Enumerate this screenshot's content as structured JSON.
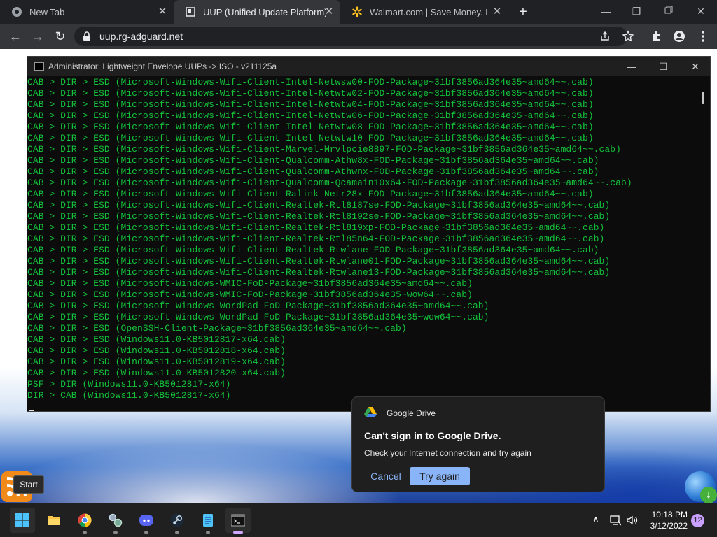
{
  "browser": {
    "tabs": [
      {
        "title": "New Tab",
        "close": "✕",
        "active": false
      },
      {
        "title": "UUP (Unified Update Platform) G",
        "close": "✕",
        "active": true
      },
      {
        "title": "Walmart.com | Save Money. Live",
        "close": "✕",
        "active": false
      }
    ],
    "new_tab": "+",
    "window_controls": {
      "minimize": "—",
      "maximize": "❐",
      "close": "✕"
    },
    "nav": {
      "back": "←",
      "forward": "→",
      "reload": "↻"
    },
    "url": "uup.rg-adguard.net",
    "icons": [
      "share-icon",
      "bookmark-star-icon",
      "extensions-icon",
      "profile-icon",
      "menu-icon"
    ]
  },
  "console": {
    "title": "Administrator:  Lightweight Envelope UUPs -> ISO - v211125a",
    "controls": {
      "minimize": "—",
      "maximize": "☐",
      "close": "✕"
    },
    "lines": [
      "CAB > DIR > ESD (Microsoft-Windows-Wifi-Client-Intel-Netwsw00-FOD-Package~31bf3856ad364e35~amd64~~.cab)",
      "CAB > DIR > ESD (Microsoft-Windows-Wifi-Client-Intel-Netwtw02-FOD-Package~31bf3856ad364e35~amd64~~.cab)",
      "CAB > DIR > ESD (Microsoft-Windows-Wifi-Client-Intel-Netwtw04-FOD-Package~31bf3856ad364e35~amd64~~.cab)",
      "CAB > DIR > ESD (Microsoft-Windows-Wifi-Client-Intel-Netwtw06-FOD-Package~31bf3856ad364e35~amd64~~.cab)",
      "CAB > DIR > ESD (Microsoft-Windows-Wifi-Client-Intel-Netwtw08-FOD-Package~31bf3856ad364e35~amd64~~.cab)",
      "CAB > DIR > ESD (Microsoft-Windows-Wifi-Client-Intel-Netwtw10-FOD-Package~31bf3856ad364e35~amd64~~.cab)",
      "CAB > DIR > ESD (Microsoft-Windows-Wifi-Client-Marvel-Mrvlpcie8897-FOD-Package~31bf3856ad364e35~amd64~~.cab)",
      "CAB > DIR > ESD (Microsoft-Windows-Wifi-Client-Qualcomm-Athw8x-FOD-Package~31bf3856ad364e35~amd64~~.cab)",
      "CAB > DIR > ESD (Microsoft-Windows-Wifi-Client-Qualcomm-Athwnx-FOD-Package~31bf3856ad364e35~amd64~~.cab)",
      "CAB > DIR > ESD (Microsoft-Windows-Wifi-Client-Qualcomm-Qcamain10x64-FOD-Package~31bf3856ad364e35~amd64~~.cab)",
      "CAB > DIR > ESD (Microsoft-Windows-Wifi-Client-Ralink-Netr28x-FOD-Package~31bf3856ad364e35~amd64~~.cab)",
      "CAB > DIR > ESD (Microsoft-Windows-Wifi-Client-Realtek-Rtl8187se-FOD-Package~31bf3856ad364e35~amd64~~.cab)",
      "CAB > DIR > ESD (Microsoft-Windows-Wifi-Client-Realtek-Rtl8192se-FOD-Package~31bf3856ad364e35~amd64~~.cab)",
      "CAB > DIR > ESD (Microsoft-Windows-Wifi-Client-Realtek-Rtl819xp-FOD-Package~31bf3856ad364e35~amd64~~.cab)",
      "CAB > DIR > ESD (Microsoft-Windows-Wifi-Client-Realtek-Rtl85n64-FOD-Package~31bf3856ad364e35~amd64~~.cab)",
      "CAB > DIR > ESD (Microsoft-Windows-Wifi-Client-Realtek-Rtwlane-FOD-Package~31bf3856ad364e35~amd64~~.cab)",
      "CAB > DIR > ESD (Microsoft-Windows-Wifi-Client-Realtek-Rtwlane01-FOD-Package~31bf3856ad364e35~amd64~~.cab)",
      "CAB > DIR > ESD (Microsoft-Windows-Wifi-Client-Realtek-Rtwlane13-FOD-Package~31bf3856ad364e35~amd64~~.cab)",
      "CAB > DIR > ESD (Microsoft-Windows-WMIC-FoD-Package~31bf3856ad364e35~amd64~~.cab)",
      "CAB > DIR > ESD (Microsoft-Windows-WMIC-FoD-Package~31bf3856ad364e35~wow64~~.cab)",
      "CAB > DIR > ESD (Microsoft-Windows-WordPad-FoD-Package~31bf3856ad364e35~amd64~~.cab)",
      "CAB > DIR > ESD (Microsoft-Windows-WordPad-FoD-Package~31bf3856ad364e35~wow64~~.cab)",
      "CAB > DIR > ESD (OpenSSH-Client-Package~31bf3856ad364e35~amd64~~.cab)",
      "CAB > DIR > ESD (Windows11.0-KB5012817-x64.cab)",
      "CAB > DIR > ESD (Windows11.0-KB5012818-x64.cab)",
      "CAB > DIR > ESD (Windows11.0-KB5012819-x64.cab)",
      "CAB > DIR > ESD (Windows11.0-KB5012820-x64.cab)",
      "PSF > DIR (Windows11.0-KB5012817-x64)",
      "DIR > CAB (Windows11.0-KB5012817-x64)"
    ],
    "text_color": "#13c23a"
  },
  "toast": {
    "app": "Google Drive",
    "heading": "Can't sign in to Google Drive.",
    "message": "Check your Internet connection and try again",
    "cancel": "Cancel",
    "retry": "Try again"
  },
  "desktop": {
    "start_tooltip": "Start"
  },
  "taskbar": {
    "apps": [
      {
        "name": "start-button",
        "icon": "windows-logo-icon",
        "active": true
      },
      {
        "name": "file-explorer",
        "icon": "folder-icon",
        "active": false
      },
      {
        "name": "chrome",
        "icon": "chrome-icon",
        "active": false
      },
      {
        "name": "app-gears",
        "icon": "gears-icon",
        "active": false
      },
      {
        "name": "discord",
        "icon": "discord-icon",
        "active": false
      },
      {
        "name": "steam",
        "icon": "steam-icon",
        "active": false
      },
      {
        "name": "notepad",
        "icon": "notepad-icon",
        "active": false
      },
      {
        "name": "terminal",
        "icon": "terminal-icon",
        "active": true
      }
    ],
    "tray_chevron": "∧",
    "clock_time": "10:18 PM",
    "clock_date": "3/12/2022",
    "notification_count": "12"
  }
}
